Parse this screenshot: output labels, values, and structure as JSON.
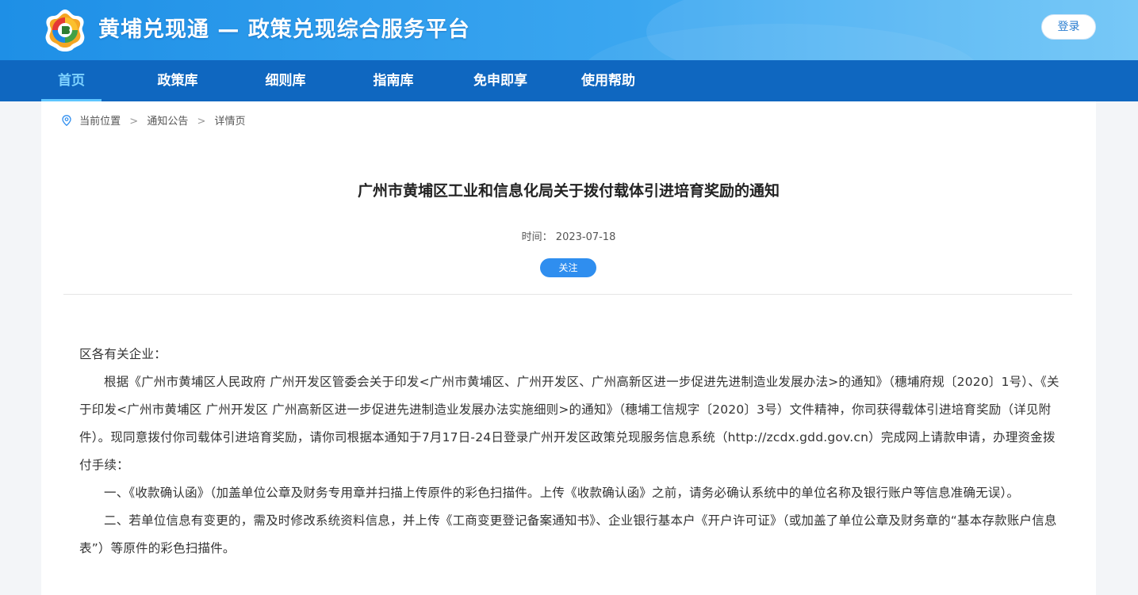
{
  "header": {
    "site_title": "黄埔兑现通 — 政策兑现综合服务平台",
    "login_label": "登录"
  },
  "nav": {
    "items": [
      {
        "label": "首页",
        "active": true
      },
      {
        "label": "政策库",
        "active": false
      },
      {
        "label": "细则库",
        "active": false
      },
      {
        "label": "指南库",
        "active": false
      },
      {
        "label": "免申即享",
        "active": false
      },
      {
        "label": "使用帮助",
        "active": false
      }
    ]
  },
  "breadcrumb": {
    "current_label": "当前位置",
    "items": [
      "通知公告",
      "详情页"
    ],
    "separator": ">"
  },
  "article": {
    "title": "广州市黄埔区工业和信息化局关于拨付载体引进培育奖励的通知",
    "time_label": "时间：",
    "time_value": "2023-07-18",
    "follow_label": "关注",
    "paragraphs": [
      "区各有关企业：",
      "根据《广州市黄埔区人民政府 广州开发区管委会关于印发<广州市黄埔区、广州开发区、广州高新区进一步促进先进制造业发展办法>的通知》（穗埔府规〔2020〕1号）、《关于印发<广州市黄埔区 广州开发区 广州高新区进一步促进先进制造业发展办法实施细则>的通知》（穗埔工信规字〔2020〕3号）文件精神，你司获得载体引进培育奖励（详见附件）。现同意拨付你司载体引进培育奖励，请你司根据本通知于7月17日-24日登录广州开发区政策兑现服务信息系统（http://zcdx.gdd.gov.cn）完成网上请款申请，办理资金拨付手续：",
      "一、《收款确认函》（加盖单位公章及财务专用章并扫描上传原件的彩色扫描件。上传《收款确认函》之前，请务必确认系统中的单位名称及银行账户等信息准确无误）。",
      "二、若单位信息有变更的，需及时修改系统资料信息，并上传《工商变更登记备案通知书》、企业银行基本户《开户许可证》（或加盖了单位公章及财务章的“基本存款账户信息表”）等原件的彩色扫描件。"
    ]
  },
  "colors": {
    "header_gradient_start": "#1e8fe6",
    "nav_bg": "#0f67c0",
    "nav_active": "#7fd3ff",
    "follow_button": "#2f8eef"
  }
}
